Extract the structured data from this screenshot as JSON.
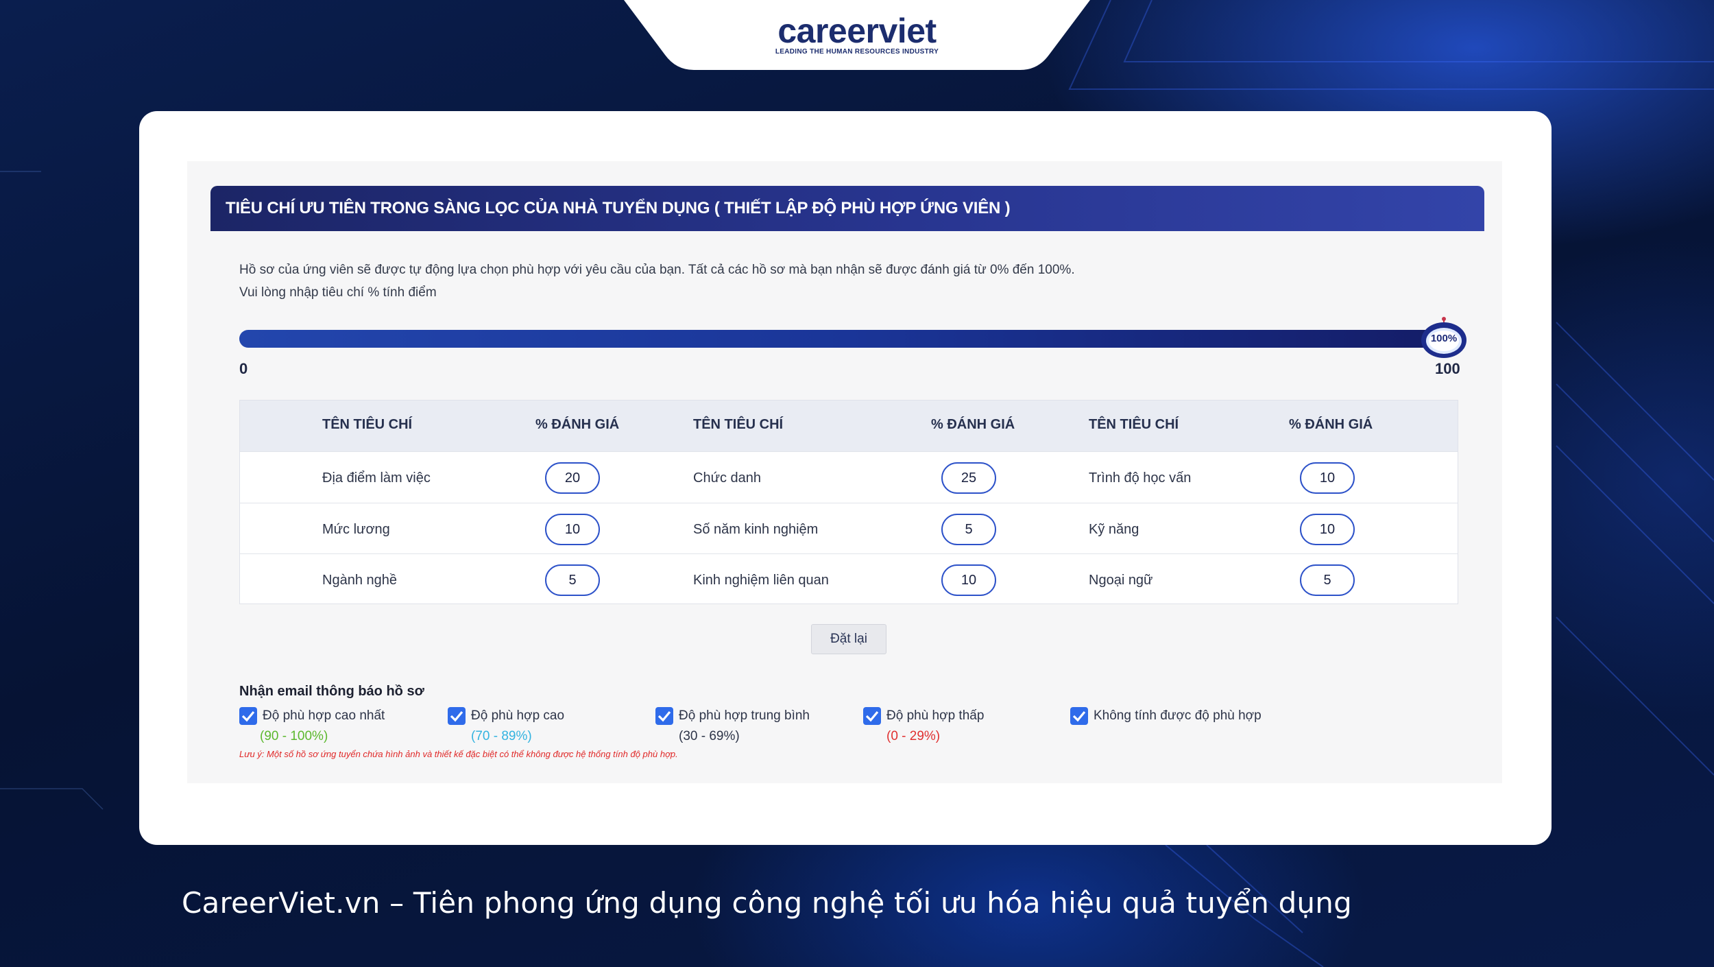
{
  "brand": {
    "logo_text": "careerviet",
    "logo_tagline": "LEADING THE HUMAN RESOURCES INDUSTRY"
  },
  "panel": {
    "title": "TIÊU CHÍ ƯU TIÊN TRONG SÀNG LỌC CỦA NHÀ TUYỂN DỤNG ( THIẾT LẬP ĐỘ PHÙ HỢP ỨNG VIÊN )",
    "description_1": "Hồ sơ của ứng viên sẽ được tự động lựa chọn phù hợp với yêu cầu của bạn. Tất cả các hồ sơ mà bạn nhận sẽ được đánh giá từ 0% đến 100%.",
    "description_2": "Vui lòng nhập tiêu chí % tính điểm"
  },
  "slider": {
    "min_label": "0",
    "max_label": "100",
    "value_label": "100%",
    "value_fraction": 1.0,
    "track_color_start": "#2346ad",
    "track_color_end": "#141c66"
  },
  "table": {
    "headers": [
      "TÊN TIÊU CHÍ",
      "% ĐÁNH GIÁ",
      "TÊN TIÊU CHÍ",
      "% ĐÁNH GIÁ",
      "TÊN TIÊU CHÍ",
      "% ĐÁNH GIÁ"
    ],
    "rows": [
      [
        {
          "name": "Địa điểm làm việc",
          "value": "20"
        },
        {
          "name": "Chức danh",
          "value": "25"
        },
        {
          "name": "Trình độ học vấn",
          "value": "10"
        }
      ],
      [
        {
          "name": "Mức lương",
          "value": "10"
        },
        {
          "name": "Số năm kinh nghiệm",
          "value": "5"
        },
        {
          "name": "Kỹ năng",
          "value": "10"
        }
      ],
      [
        {
          "name": "Ngành nghề",
          "value": "5"
        },
        {
          "name": "Kinh nghiệm liên quan",
          "value": "10"
        },
        {
          "name": "Ngoại ngữ",
          "value": "5"
        }
      ]
    ]
  },
  "reset_label": "Đặt lại",
  "email": {
    "title": "Nhận email thông báo hồ sơ",
    "options": [
      {
        "label": "Độ phù hợp cao nhất",
        "range": "(90 - 100%)",
        "range_color": "#5cb82e",
        "checked": true
      },
      {
        "label": "Độ phù hợp cao",
        "range": "(70 - 89%)",
        "range_color": "#33b3e0",
        "checked": true
      },
      {
        "label": "Độ phù hợp trung bình",
        "range": "(30 - 69%)",
        "range_color": "#2d3448",
        "checked": true
      },
      {
        "label": "Độ phù hợp thấp",
        "range": "(0 - 29%)",
        "range_color": "#e03030",
        "checked": true
      },
      {
        "label": "Không tính được độ phù hợp",
        "range": "",
        "range_color": "#2d3448",
        "checked": true
      }
    ],
    "note": "Lưu ý: Một số hồ sơ ứng tuyển chứa hình ảnh và thiết kế đặc biệt có thể không được hệ thống tính độ phù hợp."
  },
  "tagline": "CareerViet.vn – Tiên phong ứng dụng công nghệ tối ưu hóa hiệu quả tuyển dụng",
  "colors": {
    "header_navy": "#1c2566",
    "accent_blue": "#2d52c9",
    "checkbox_blue": "#2f6bea"
  }
}
